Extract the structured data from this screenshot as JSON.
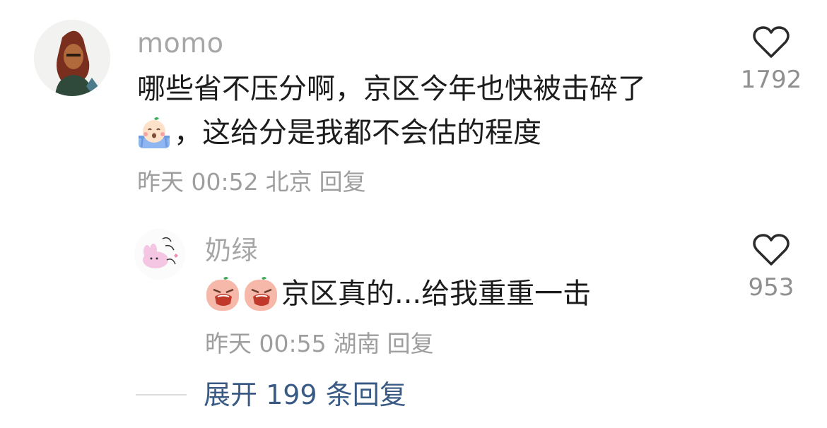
{
  "comments": [
    {
      "author": "momo",
      "text_line1": "哪些省不压分啊，京区今年也快被击碎了",
      "emoji": "crying-face-emoji",
      "text_line2": "，这给分是我都不会估的程度",
      "time": "昨天 00:52",
      "location": "北京",
      "reply_label": "回复",
      "likes": "1792"
    }
  ],
  "reply": {
    "author": "奶绿",
    "emoji": "wailing-face-emoji",
    "text": "京区真的...给我重重一击",
    "time": "昨天 00:55",
    "location": "湖南",
    "reply_label": "回复",
    "likes": "953"
  },
  "expand_label": "展开 199 条回复",
  "colors": {
    "author": "#a6a6a6",
    "text": "#1c1c1c",
    "meta": "#9e9e9e",
    "expand": "#3a5a86"
  }
}
